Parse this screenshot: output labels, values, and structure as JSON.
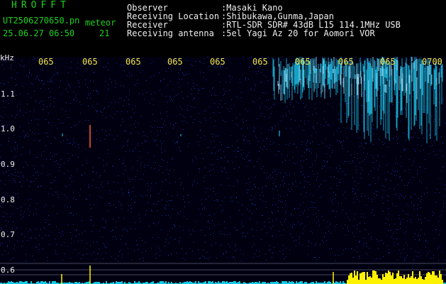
{
  "header": {
    "app_title": "HROFFT",
    "file_name": "UT2506270650.pn",
    "file_tag": "meteor",
    "date_time": "25.06.27 06:50",
    "count": "21",
    "observer_label": "Observer",
    "observer_value": ":Masaki Kano",
    "location_label": "Receiving Location",
    "location_value": ":Shibukawa,Gunma,Japan",
    "receiver_label": "Receiver",
    "receiver_value": ":RTL-SDR SDR# 43dB L15 114.1MHz USB",
    "antenna_label": "Receiving antenna",
    "antenna_value": ":5el Yagi Az 20 for Aomori VOR"
  },
  "spectrogram": {
    "unit": "kHz",
    "time_ticks": [
      "065",
      "065",
      "065",
      "065",
      "065",
      "065",
      "065",
      "065",
      "065",
      "0700"
    ],
    "freq_labels": [
      "1.1",
      "1.0",
      "0.9",
      "0.8",
      "0.7",
      "0.6"
    ],
    "colors": {
      "background": "#000010",
      "noise": "#1a2ea8",
      "echo": "#9fe8ff",
      "trace": "#22d6ff",
      "burst": "#fff200",
      "axis_text": "#f5e64a"
    }
  }
}
